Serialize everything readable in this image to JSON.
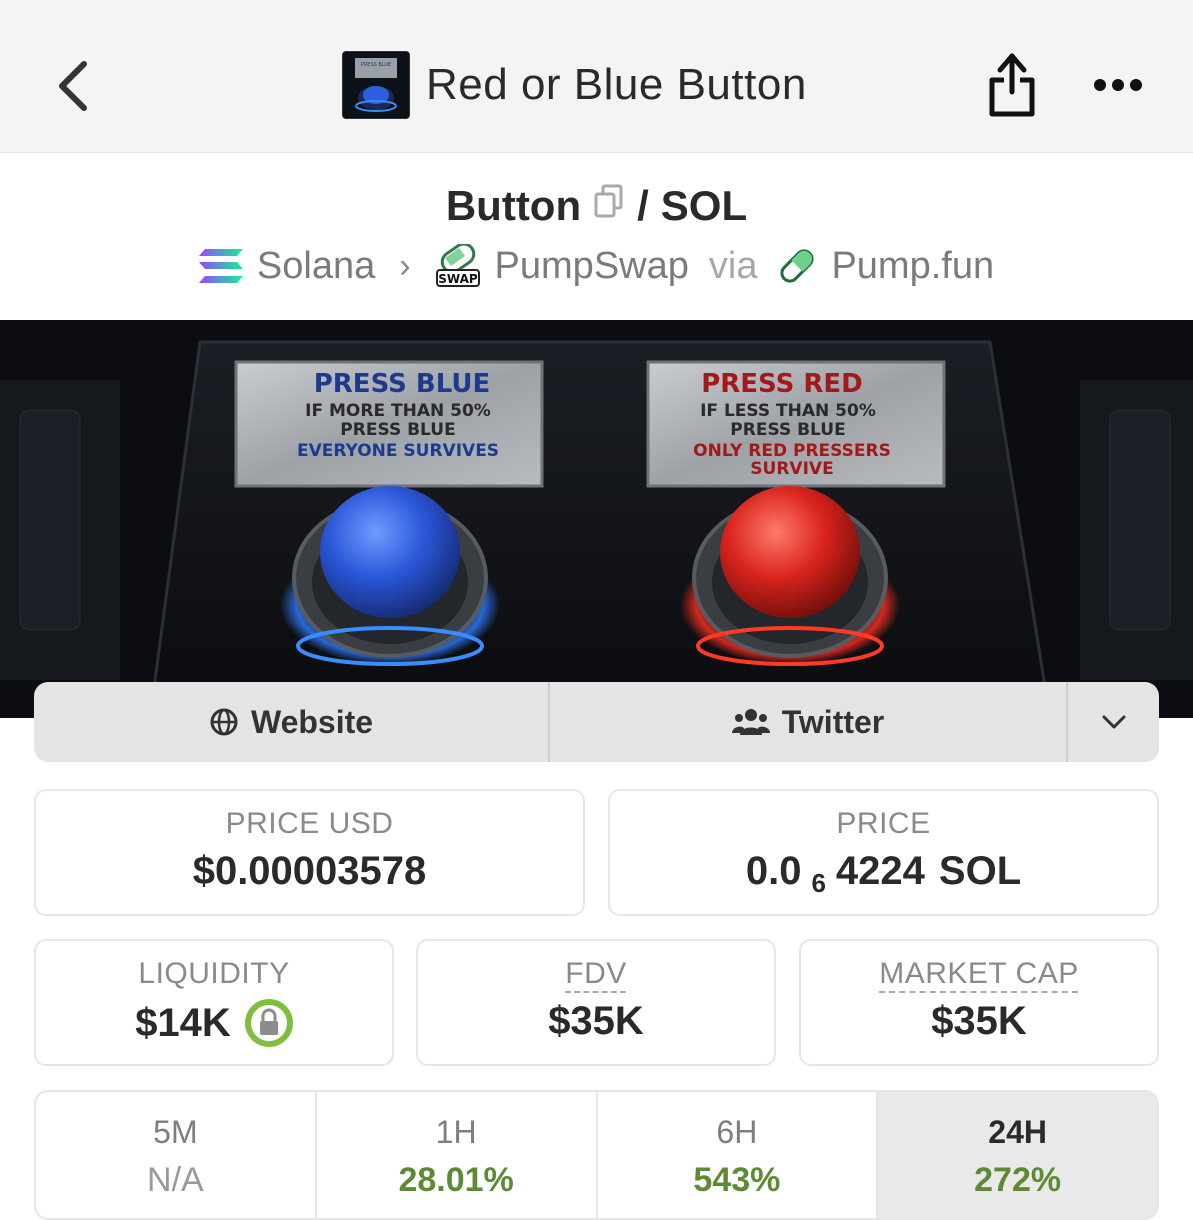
{
  "header": {
    "title": "Red or Blue Button",
    "thumb_text": "PRESS BLUE"
  },
  "pair": {
    "base": "Button",
    "separator": "/",
    "quote": "SOL"
  },
  "chain": {
    "network": "Solana",
    "dex": "PumpSwap",
    "dex_badge": "SWAP",
    "via": "via",
    "launchpad": "Pump.fun"
  },
  "banner": {
    "blue_sign": {
      "title": "PRESS BLUE",
      "line1": "IF MORE THAN 50%",
      "line2": "PRESS BLUE",
      "line3": "EVERYONE SURVIVES"
    },
    "red_sign": {
      "title": "PRESS RED",
      "line1": "IF LESS THAN 50%",
      "line2": "PRESS BLUE",
      "line3": "ONLY RED PRESSERS",
      "line4": "SURVIVE"
    }
  },
  "links": {
    "website": "Website",
    "twitter": "Twitter"
  },
  "stats": {
    "price_usd": {
      "label": "PRICE USD",
      "value": "$0.00003578"
    },
    "price_native": {
      "label": "PRICE",
      "prefix": "0.0",
      "zeros": "6",
      "digits": "4224",
      "unit": "SOL"
    },
    "liquidity": {
      "label": "LIQUIDITY",
      "value": "$14K"
    },
    "fdv": {
      "label": "FDV",
      "value": "$35K"
    },
    "market_cap": {
      "label": "MARKET CAP",
      "value": "$35K"
    }
  },
  "timeframes": [
    {
      "label": "5M",
      "value": "N/A"
    },
    {
      "label": "1H",
      "value": "28.01%"
    },
    {
      "label": "6H",
      "value": "543%"
    },
    {
      "label": "24H",
      "value": "272%"
    }
  ],
  "colors": {
    "positive": "#5e8a34",
    "lock_green": "#7fbf3f",
    "solana_gradient": [
      "#9945ff",
      "#14f195"
    ]
  }
}
